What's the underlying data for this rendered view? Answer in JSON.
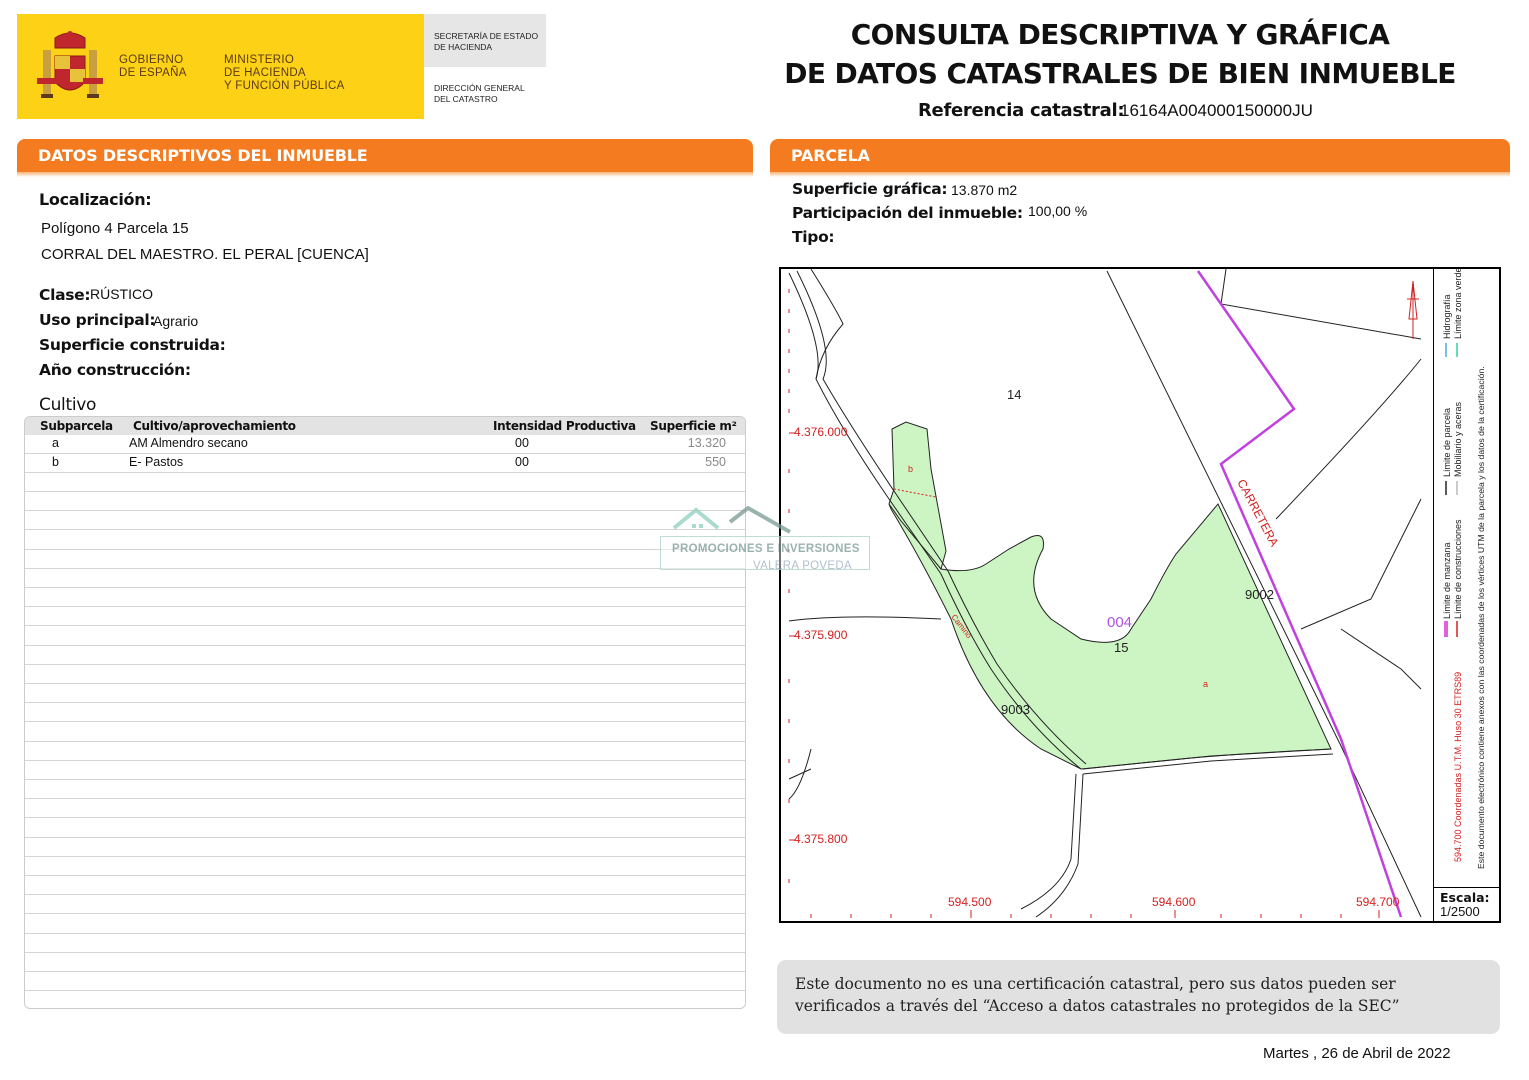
{
  "header": {
    "gov_label": "GOBIERNO\nDE ESPAÑA",
    "ministry_label": "MINISTERIO\nDE HACIENDA\nY FUNCIÓN PÚBLICA",
    "secretaria_label": "SECRETARÍA DE ESTADO\nDE HACIENDA",
    "direccion_label": "DIRECCIÓN GENERAL\nDEL CATASTRO",
    "title": "CONSULTA DESCRIPTIVA Y GRÁFICA\nDE DATOS CATASTRALES DE BIEN INMUEBLE",
    "ref_label": "Referencia catastral:",
    "ref_value": "16164A004000150000JU"
  },
  "left": {
    "section_title": "DATOS DESCRIPTIVOS DEL INMUEBLE",
    "localizacion_label": "Localización:",
    "localizacion_line1": "Polígono 4 Parcela 15",
    "localizacion_line2": "CORRAL DEL MAESTRO. EL PERAL [CUENCA]",
    "clase_label": "Clase:",
    "clase_value": "RÚSTICO",
    "uso_label": "Uso principal:",
    "uso_value": "Agrario",
    "sup_construida_label": "Superficie construida:",
    "anio_label": "Año construcción:",
    "cultivo_title": "Cultivo",
    "table": {
      "headers": [
        "Subparcela",
        "Cultivo/aprovechamiento",
        "Intensidad Productiva",
        "Superficie m²"
      ],
      "rows": [
        [
          "a",
          "AM Almendro secano",
          "00",
          "13.320"
        ],
        [
          "b",
          "E- Pastos",
          "00",
          "550"
        ]
      ]
    }
  },
  "right": {
    "section_title": "PARCELA",
    "sup_grafica_label": "Superficie gráfica:",
    "sup_grafica_value": "13.870 m2",
    "participacion_label": "Participación del inmueble:",
    "participacion_value": "100,00 %",
    "tipo_label": "Tipo:",
    "map": {
      "y_labels": [
        "4.376.000",
        "4.375.900",
        "4.375.800"
      ],
      "x_labels": [
        "594.500",
        "594.600",
        "594.700"
      ],
      "parcel_labels": [
        "14",
        "004",
        "15",
        "9002",
        "9003",
        "a",
        "b"
      ],
      "road_label": "CARRETERA",
      "path_label": "Camino",
      "legend": {
        "col1_a": "Límite de manzana",
        "col1_b": "Límite de parcela",
        "col1_c": "Hidrografía",
        "col2_a": "Límite de construcciones",
        "col2_b": "Mobiliario y aceras",
        "col2_c": "Límite zona verde",
        "coords_note": "594.700 Coordenadas U.T.M. Huso 30 ETRS89",
        "electronic_note": "Este documento electrónico contiene anexos con las coordenadas de los vértices UTM de la parcela y los datos de la certificación."
      },
      "scale_label": "Escala:",
      "scale_value": "1/2500",
      "colors": {
        "parcel_fill": "#ccf5c3",
        "road": "#c040e0",
        "labels": "#d42020"
      }
    }
  },
  "footer": {
    "note": "Este documento no es una certificación catastral, pero sus datos pueden ser verificados a través del “Acceso a datos catastrales no protegidos de la SEC”",
    "date": "Martes , 26 de Abril de 2022"
  },
  "watermark": {
    "line1": "PROMOCIONES E INVERSIONES",
    "line2": "VALERA POVEDA"
  }
}
